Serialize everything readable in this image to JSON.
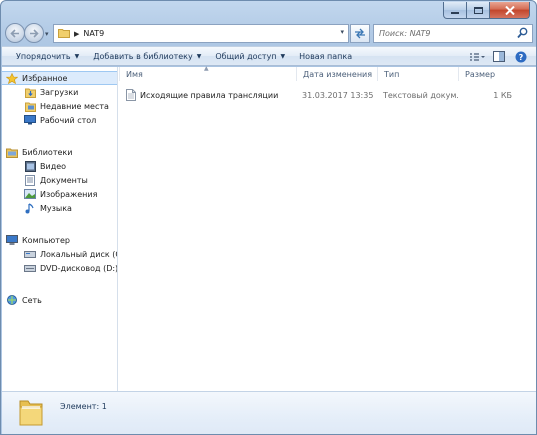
{
  "window": {
    "colors": {
      "accent": "#3c78b5",
      "frame": "#a9c3e1",
      "selection": "#dcebfc",
      "close": "#c2452b"
    }
  },
  "address": {
    "crumb": "NAT9"
  },
  "search": {
    "placeholder": "Поиск: NAT9"
  },
  "toolbar": {
    "organize_label": "Упорядочить",
    "add_to_library_label": "Добавить в библиотеку",
    "share_label": "Общий доступ",
    "new_folder_label": "Новая папка"
  },
  "sidebar": {
    "favorites": {
      "label": "Избранное",
      "items": [
        {
          "label": "Загрузки",
          "icon": "downloads-icon"
        },
        {
          "label": "Недавние места",
          "icon": "recent-places-icon"
        },
        {
          "label": "Рабочий стол",
          "icon": "desktop-icon"
        }
      ]
    },
    "libraries": {
      "label": "Библиотеки",
      "items": [
        {
          "label": "Видео",
          "icon": "video-icon"
        },
        {
          "label": "Документы",
          "icon": "documents-icon"
        },
        {
          "label": "Изображения",
          "icon": "pictures-icon"
        },
        {
          "label": "Музыка",
          "icon": "music-icon"
        }
      ]
    },
    "computer": {
      "label": "Компьютер",
      "items": [
        {
          "label": "Локальный диск (C",
          "icon": "local-disk-icon"
        },
        {
          "label": "DVD-дисковод (D:) •",
          "icon": "dvd-drive-icon"
        }
      ]
    },
    "network": {
      "label": "Сеть",
      "icon": "network-icon"
    }
  },
  "columns": {
    "name": "Имя",
    "modified": "Дата изменения",
    "type": "Тип",
    "size": "Размер"
  },
  "files": [
    {
      "name": "Исходящие правила трансляции",
      "modified": "31.03.2017 13:35",
      "type": "Текстовый докум...",
      "size": "1 КБ",
      "icon": "text-file-icon"
    }
  ],
  "status": {
    "items_text": "Элемент: 1"
  }
}
